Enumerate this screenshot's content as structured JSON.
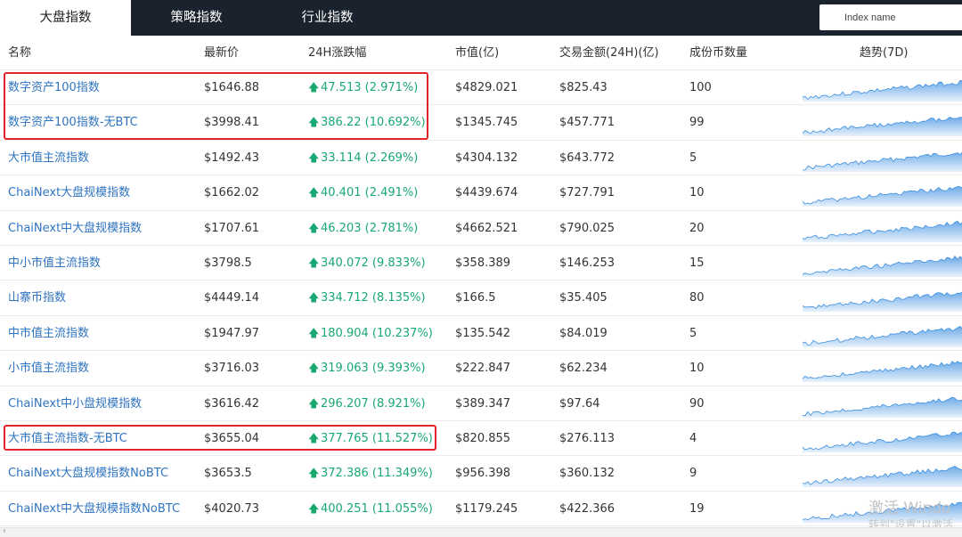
{
  "tabs": [
    {
      "label": "大盘指数",
      "active": true
    },
    {
      "label": "策略指数",
      "active": false
    },
    {
      "label": "行业指数",
      "active": false
    }
  ],
  "search": {
    "placeholder": "Index name"
  },
  "columns": [
    "名称",
    "最新价",
    "24H涨跌幅",
    "市值(亿)",
    "交易金额(24H)(亿)",
    "成份币数量",
    "趋势(7D)"
  ],
  "rows": [
    {
      "name": "数字资产100指数",
      "price": "$1646.88",
      "change": "47.513 (2.971%)",
      "mcap": "$4829.021",
      "volume": "$825.43",
      "count": "100"
    },
    {
      "name": "数字资产100指数-无BTC",
      "price": "$3998.41",
      "change": "386.22 (10.692%)",
      "mcap": "$1345.745",
      "volume": "$457.771",
      "count": "99"
    },
    {
      "name": "大市值主流指数",
      "price": "$1492.43",
      "change": "33.114 (2.269%)",
      "mcap": "$4304.132",
      "volume": "$643.772",
      "count": "5"
    },
    {
      "name": "ChaiNext大盘规模指数",
      "price": "$1662.02",
      "change": "40.401 (2.491%)",
      "mcap": "$4439.674",
      "volume": "$727.791",
      "count": "10"
    },
    {
      "name": "ChaiNext中大盘规模指数",
      "price": "$1707.61",
      "change": "46.203 (2.781%)",
      "mcap": "$4662.521",
      "volume": "$790.025",
      "count": "20"
    },
    {
      "name": "中小市值主流指数",
      "price": "$3798.5",
      "change": "340.072 (9.833%)",
      "mcap": "$358.389",
      "volume": "$146.253",
      "count": "15"
    },
    {
      "name": "山寨币指数",
      "price": "$4449.14",
      "change": "334.712 (8.135%)",
      "mcap": "$166.5",
      "volume": "$35.405",
      "count": "80"
    },
    {
      "name": "中市值主流指数",
      "price": "$1947.97",
      "change": "180.904 (10.237%)",
      "mcap": "$135.542",
      "volume": "$84.019",
      "count": "5"
    },
    {
      "name": "小市值主流指数",
      "price": "$3716.03",
      "change": "319.063 (9.393%)",
      "mcap": "$222.847",
      "volume": "$62.234",
      "count": "10"
    },
    {
      "name": "ChaiNext中小盘规模指数",
      "price": "$3616.42",
      "change": "296.207 (8.921%)",
      "mcap": "$389.347",
      "volume": "$97.64",
      "count": "90"
    },
    {
      "name": "大市值主流指数-无BTC",
      "price": "$3655.04",
      "change": "377.765 (11.527%)",
      "mcap": "$820.855",
      "volume": "$276.113",
      "count": "4"
    },
    {
      "name": "ChaiNext大盘规模指数NoBTC",
      "price": "$3653.5",
      "change": "372.386 (11.349%)",
      "mcap": "$956.398",
      "volume": "$360.132",
      "count": "9"
    },
    {
      "name": "ChaiNext中大盘规模指数NoBTC",
      "price": "$4020.73",
      "change": "400.251 (11.055%)",
      "mcap": "$1179.245",
      "volume": "$422.366",
      "count": "19"
    }
  ],
  "watermark": {
    "line1": "激活 Windo",
    "line2": "转到\"设置\"以激活"
  },
  "colors": {
    "header_bg": "#1a222d",
    "link": "#2f74c0",
    "up": "#19a872",
    "highlight": "#e5232a",
    "sparkline": "#3d8fe0"
  },
  "icons": {
    "up_arrow": "up-arrow-icon",
    "scroll_left": "chevron-left-icon"
  }
}
